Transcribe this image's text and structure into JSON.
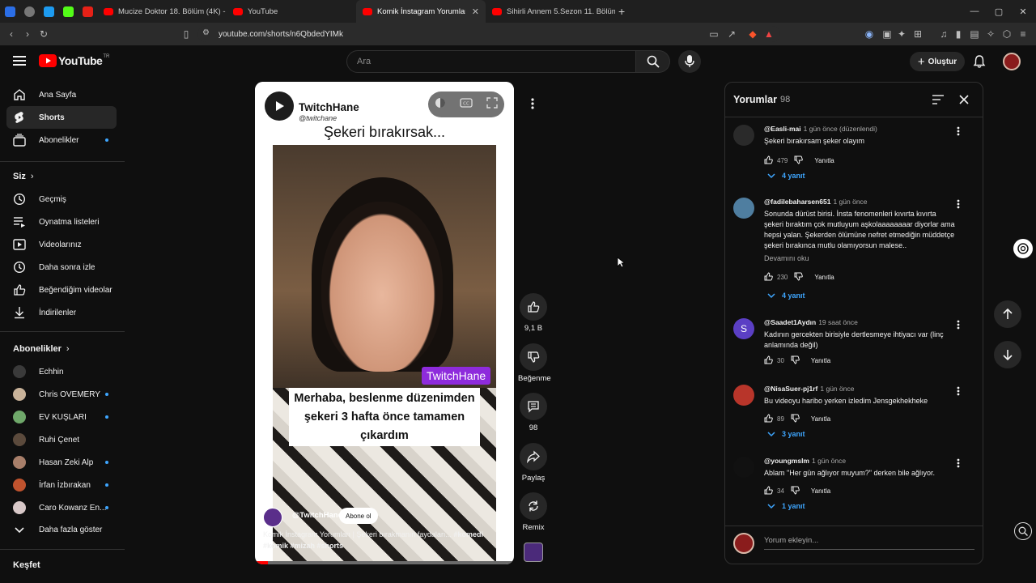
{
  "browser": {
    "tabs": [
      {
        "label": "Mucize Doktor 18. Bölüm (4K) - YouT",
        "active": false
      },
      {
        "label": "YouTube",
        "active": false
      },
      {
        "label": "Komik İnstagram Yorumları | Ş",
        "active": true
      },
      {
        "label": "Sihirli Annem 5.Sezon 11. Bölüm - Yo",
        "active": false
      }
    ],
    "new_tab": "+",
    "url": "youtube.com/shorts/n6QbdedYIMk",
    "min": "—",
    "max": "▢",
    "close": "✕"
  },
  "header": {
    "logo_text": "YouTube",
    "logo_sup": "TR",
    "search_placeholder": "Ara",
    "create_label": "Oluştur"
  },
  "sidebar": {
    "main": [
      {
        "label": "Ana Sayfa",
        "icon": "home-icon"
      },
      {
        "label": "Shorts",
        "icon": "shorts-icon",
        "active": true
      },
      {
        "label": "Abonelikler",
        "icon": "subscriptions-icon",
        "dot": true
      }
    ],
    "you_title": "Siz",
    "you": [
      {
        "label": "Geçmiş",
        "icon": "history-icon"
      },
      {
        "label": "Oynatma listeleri",
        "icon": "playlists-icon"
      },
      {
        "label": "Videolarınız",
        "icon": "your-videos-icon"
      },
      {
        "label": "Daha sonra izle",
        "icon": "watch-later-icon"
      },
      {
        "label": "Beğendiğim videolar",
        "icon": "liked-icon"
      },
      {
        "label": "İndirilenler",
        "icon": "download-icon"
      }
    ],
    "subs_title": "Abonelikler",
    "subs": [
      {
        "label": "Echhin",
        "color": "#3a3a3a",
        "dot": false
      },
      {
        "label": "Chris OVEMERY",
        "color": "#c9b39a",
        "dot": true
      },
      {
        "label": "EV KUŞLARI",
        "color": "#6fa86a",
        "dot": true
      },
      {
        "label": "Ruhi Çenet",
        "color": "#5b4a3c",
        "dot": false
      },
      {
        "label": "Hasan Zeki Alp",
        "color": "#a87f6a",
        "dot": true
      },
      {
        "label": "İrfan İzbırakan",
        "color": "#c0532e",
        "dot": true
      },
      {
        "label": "Caro Kowanz En...",
        "color": "#d8c8c8",
        "dot": true
      }
    ],
    "show_more": "Daha fazla göster",
    "explore_title": "Keşfet"
  },
  "short": {
    "channel": "TwitchHane",
    "handle": "@twitchane",
    "title": "Şekeri bırakırsak...",
    "badge": "TwitchHane",
    "caption": "Merhaba, beslenme düzenimden şekeri 3 hafta önce tamamen çıkardım",
    "channel_tag": "@TwitchHane",
    "subscribe": "Abone ol",
    "desc": "Komik İnstagram Yorumları | Şekeri bırakmanın faydaları...",
    "hashtags": "#komedi #komik #mizah #shorts",
    "progress": 0.05
  },
  "actions": {
    "likes": "9,1 B",
    "dislike": "Beğenme",
    "comments": "98",
    "share": "Paylaş",
    "remix": "Remix"
  },
  "comments": {
    "title": "Yorumlar",
    "count": "98",
    "reply_label": "Yanıtla",
    "items": [
      {
        "author": "@Easli-mai",
        "time": "1 gün önce (düzenlendi)",
        "text": "Şekeri  bırakırsam şeker olayım",
        "likes": "479",
        "replies": "4 yanıt",
        "color": "#2a2a2a"
      },
      {
        "author": "@fadilebaharsen651",
        "time": "1 gün önce",
        "text": "Sonunda dürüst birisi. İnsta fenomenleri kıvırta kıvırta şekeri bıraktım çok mutluyum aşkolaaaaaaaar diyorlar ama hepsi yalan. Şekerden ölümüne nefret etmediğin müddetçe şekeri bırakınca mutlu olamıyorsun malese..",
        "more": "Devamını oku",
        "likes": "230",
        "replies": "4 yanıt",
        "color": "#4f7ea0"
      },
      {
        "author": "@Saadet1Aydın",
        "time": "19 saat önce",
        "text": "Kadının gercekten birisiyle dertlesmeye ihtiyacı var (linç anlamında değil)",
        "likes": "30",
        "replies": "",
        "color": "#5b3fc4",
        "initial": "S"
      },
      {
        "author": "@NisaSuer-pj1rf",
        "time": "1 gün önce",
        "text": "Bu videoyu haribo yerken izledim Jensgekhekheke",
        "likes": "89",
        "replies": "3 yanıt",
        "color": "#b8352a"
      },
      {
        "author": "@youngmslm",
        "time": "1 gün önce",
        "text": "Ablam \"Her gün ağlıyor muyum?\" derken bile ağlıyor.",
        "likes": "34",
        "replies": "1 yanıt",
        "color": "#111111"
      }
    ],
    "add_placeholder": "Yorum ekleyin..."
  }
}
